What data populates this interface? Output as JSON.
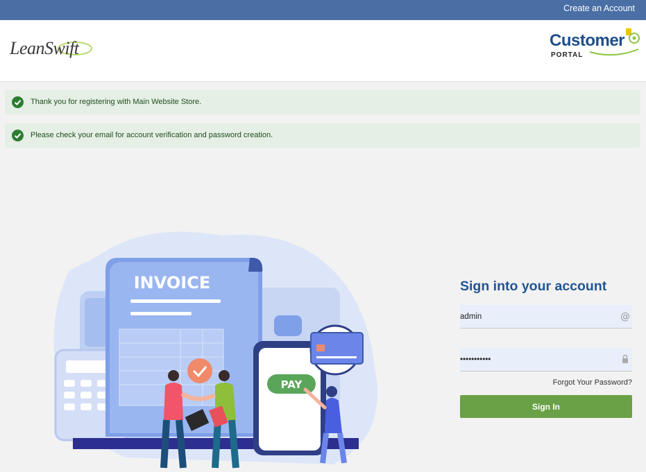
{
  "topbar": {
    "create_account": "Create an Account"
  },
  "header": {
    "brand_left": "LeanSwift",
    "brand_right_main": "Customer",
    "brand_right_sub": "PORTAL"
  },
  "messages": [
    {
      "text": "Thank you for registering with Main Website Store."
    },
    {
      "text": "Please check your email for account verification and password creation."
    }
  ],
  "illustration": {
    "invoice_label": "INVOICE",
    "pay_label": "PAY"
  },
  "signin": {
    "title": "Sign into your account",
    "username_value": "admin",
    "password_value": "•••••••••••",
    "forgot_label": "Forgot Your Password?",
    "submit_label": "Sign In"
  },
  "colors": {
    "topbar": "#4a6fa5",
    "title": "#1f5596",
    "button": "#6aa046",
    "message_bg": "#e5efe5",
    "check": "#2e7d32"
  }
}
